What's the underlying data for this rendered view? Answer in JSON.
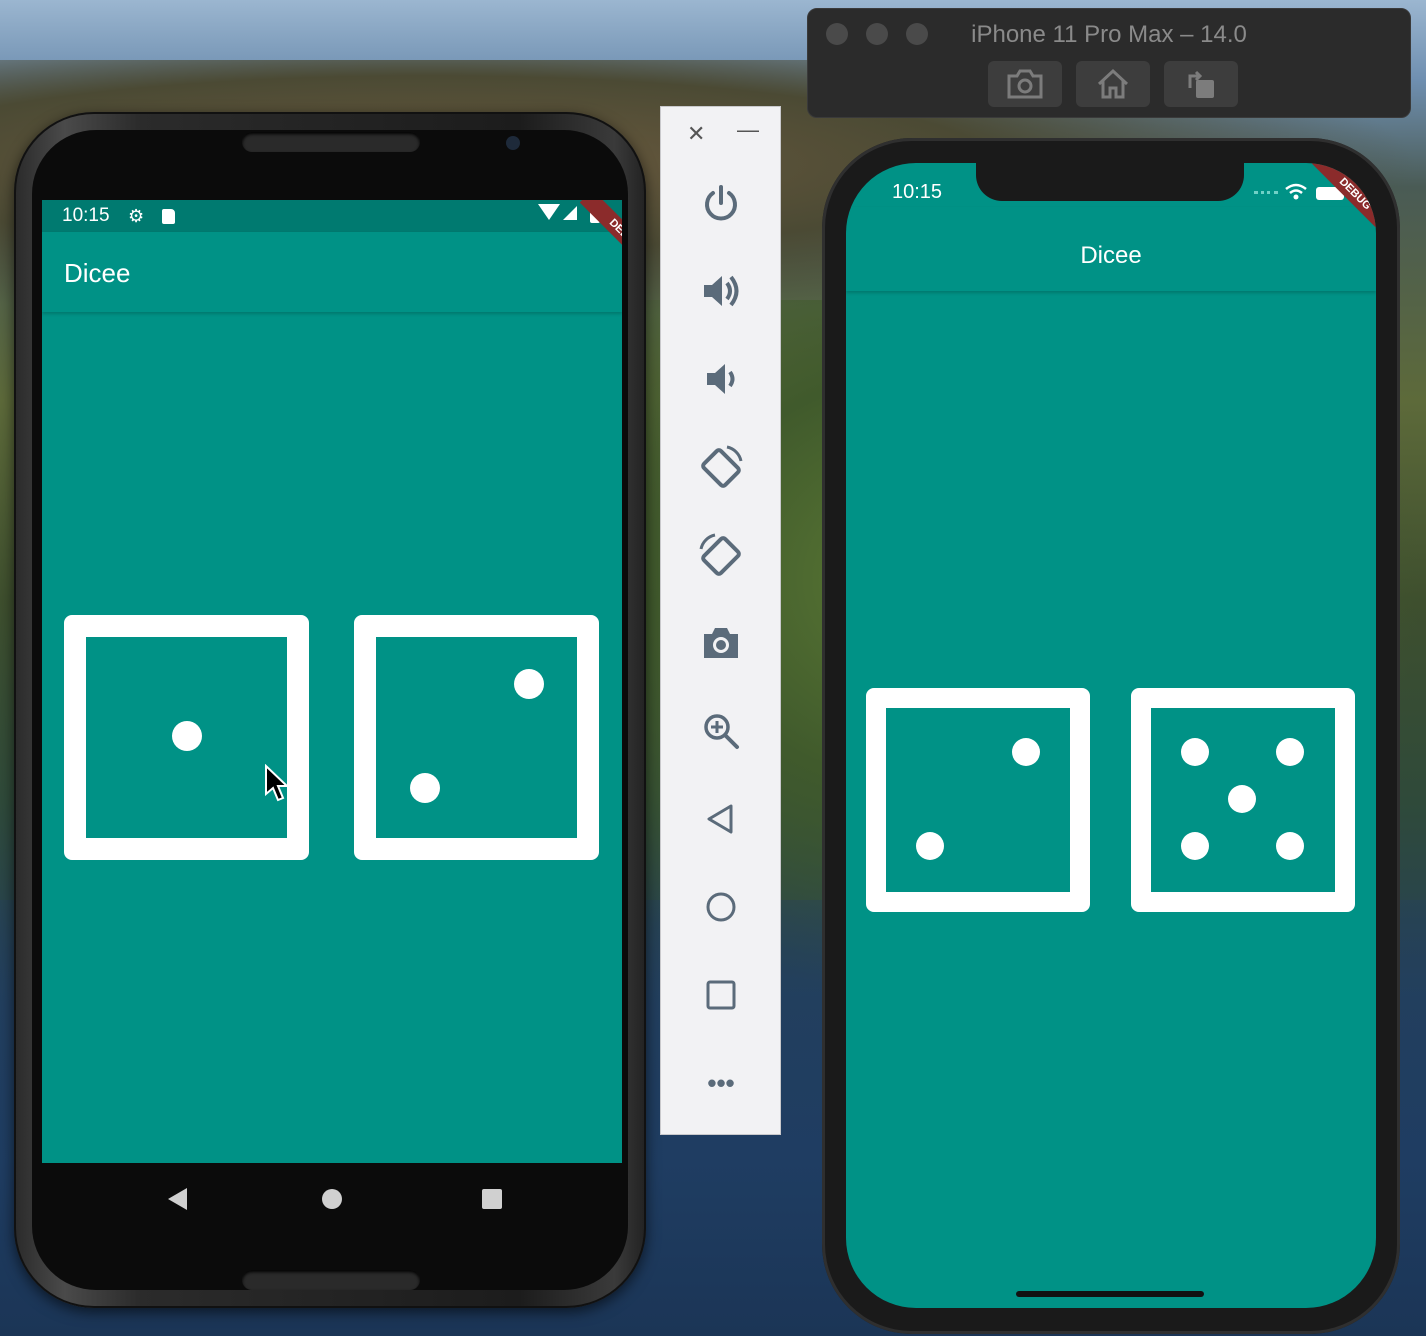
{
  "simulator_window": {
    "title": "iPhone 11 Pro Max – 14.0",
    "buttons": [
      "screenshot-icon",
      "home-icon",
      "rotate-icon"
    ]
  },
  "android": {
    "status": {
      "time": "10:15"
    },
    "app_title": "Dicee",
    "debug_banner": "DEBUG",
    "dice": {
      "left_value": 1,
      "right_value": 2
    }
  },
  "emulator_toolbar": {
    "close": "✕",
    "minimize": "—",
    "items": [
      "power-icon",
      "volume-up-icon",
      "volume-down-icon",
      "rotate-left-icon",
      "rotate-right-icon",
      "camera-icon",
      "zoom-icon",
      "back-icon",
      "home-icon",
      "overview-icon",
      "more-icon"
    ],
    "more": "•••"
  },
  "ios": {
    "status": {
      "time": "10:15"
    },
    "app_title": "Dicee",
    "debug_banner": "DEBUG",
    "dice": {
      "left_value": 2,
      "right_value": 5
    }
  },
  "colors": {
    "app_teal": "#009286",
    "status_teal": "#007a70",
    "debug_red": "#8b2b2b"
  }
}
